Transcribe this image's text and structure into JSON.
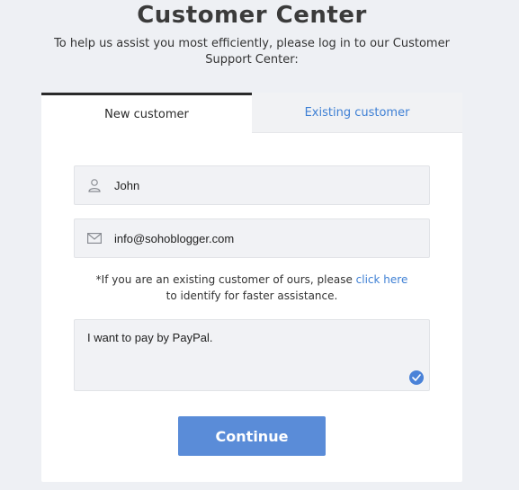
{
  "header": {
    "title": "Customer Center",
    "subtitle": "To help us assist you most efficiently, please log in to our Customer Support Center:"
  },
  "tabs": [
    {
      "label": "New customer",
      "active": true
    },
    {
      "label": "Existing customer",
      "active": false
    }
  ],
  "form": {
    "name": {
      "value": "John",
      "icon": "user-icon"
    },
    "email": {
      "value": "info@sohoblogger.com",
      "icon": "envelope-icon"
    },
    "notice": {
      "prefix": "*If you are an existing customer of ours, please ",
      "link": "click here",
      "suffix": " to identify for faster assistance."
    },
    "message": {
      "value": "I want to pay by PayPal.",
      "status_icon": "check-circle-icon"
    },
    "submit_label": "Continue"
  },
  "colors": {
    "accent": "#5a8cd8",
    "link": "#3d7fd4",
    "background": "#eef0f4"
  }
}
